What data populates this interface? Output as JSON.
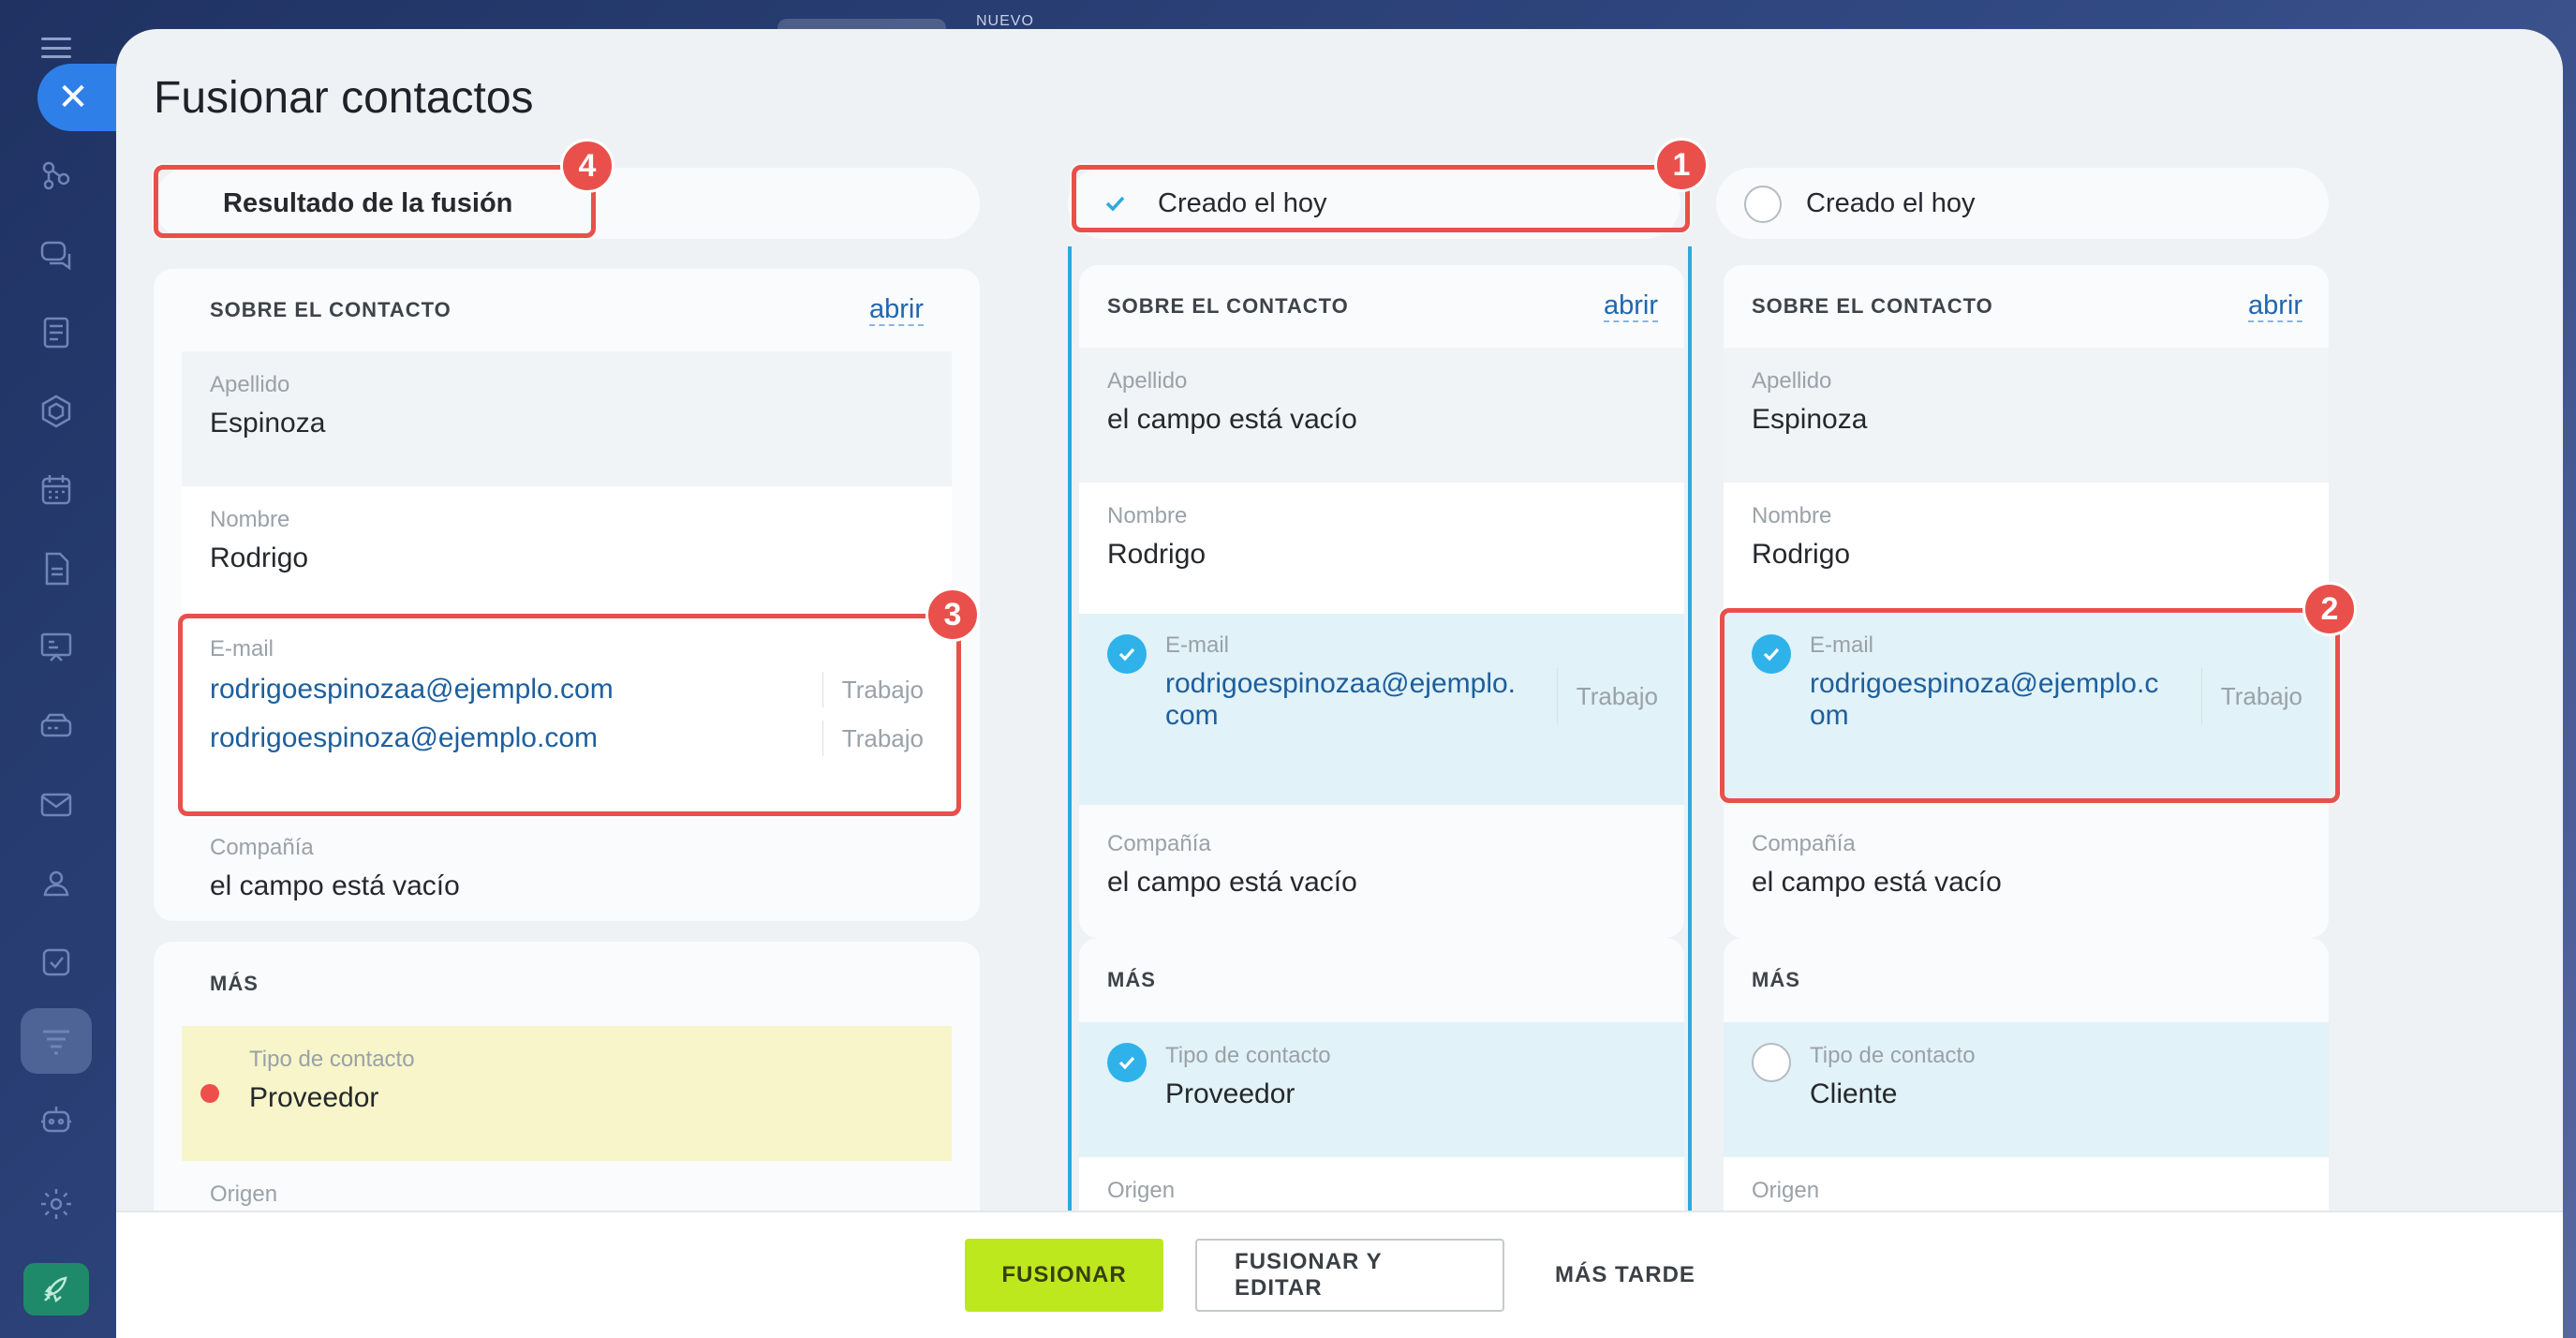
{
  "background": {
    "new_label": "NUEVO"
  },
  "dialog": {
    "title": "Fusionar contactos",
    "tabs": {
      "result": "Resultado de la fusión",
      "a": "Creado el hoy",
      "b": "Creado el hoy"
    },
    "section_contact": "SOBRE EL CONTACTO",
    "open_link": "abrir",
    "section_more": "MÁS",
    "labels": {
      "apellido": "Apellido",
      "nombre": "Nombre",
      "email": "E-mail",
      "compania": "Compañía",
      "tipo": "Tipo de contacto",
      "origen": "Origen"
    },
    "result": {
      "apellido": "Espinoza",
      "nombre": "Rodrigo",
      "emails": [
        {
          "address": "rodrigoespinozaa@ejemplo.com",
          "type": "Trabajo"
        },
        {
          "address": "rodrigoespinoza@ejemplo.com",
          "type": "Trabajo"
        }
      ],
      "compania": "el campo está vacío",
      "tipo": "Proveedor"
    },
    "contact_a": {
      "apellido": "el campo está vacío",
      "nombre": "Rodrigo",
      "email_line1": "rodrigoespinozaa@ejemplo.",
      "email_line2": "com",
      "email_type": "Trabajo",
      "compania": "el campo está vacío",
      "tipo": "Proveedor"
    },
    "contact_b": {
      "apellido": "Espinoza",
      "nombre": "Rodrigo",
      "email_line1": "rodrigoespinoza@ejemplo.c",
      "email_line2": "om",
      "email_type": "Trabajo",
      "compania": "el campo está vacío",
      "tipo": "Cliente"
    },
    "buttons": {
      "merge": "FUSIONAR",
      "merge_edit": "FUSIONAR Y EDITAR",
      "later": "MÁS TARDE"
    }
  },
  "annotations": [
    "1",
    "2",
    "3",
    "4"
  ],
  "colors": {
    "accent": "#2ca9de",
    "marker": "#e9504b",
    "primary_button": "#bde81e"
  }
}
